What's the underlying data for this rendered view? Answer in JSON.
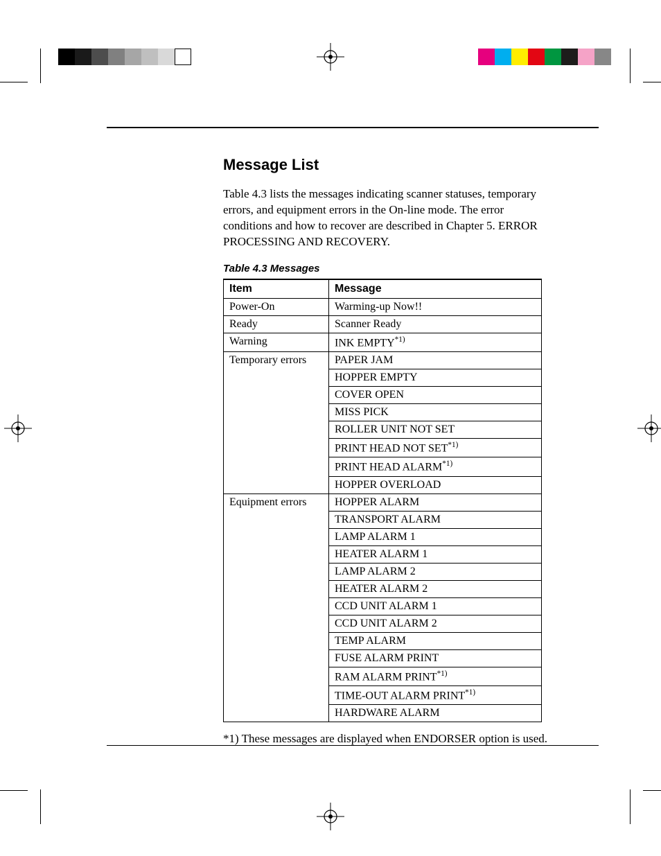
{
  "calibration": {
    "gray_shades": [
      "#000000",
      "#1a1a1a",
      "#4d4d4d",
      "#808080",
      "#a6a6a6",
      "#bfbfbf",
      "#d9d9d9",
      "#ffffff"
    ],
    "color_swatches": [
      "#e6007e",
      "#00aeef",
      "#ffed00",
      "#e30613",
      "#009640",
      "#1d1d1b",
      "#f5a3c7",
      "#878787"
    ]
  },
  "heading": "Message List",
  "intro_text": "Table 4.3 lists the messages indicating scanner statuses, temporary errors, and equipment errors in the On-line mode. The error conditions and how to recover are described in Chapter 5. ERROR PROCESSING AND RECOVERY.",
  "table": {
    "caption": "Table 4.3  Messages",
    "columns": [
      "Item",
      "Message"
    ],
    "groups": [
      {
        "item": "Power-On",
        "messages": [
          {
            "text": "Warming-up Now!!",
            "note": false
          }
        ]
      },
      {
        "item": "Ready",
        "messages": [
          {
            "text": "Scanner Ready",
            "note": false
          }
        ]
      },
      {
        "item": "Warning",
        "messages": [
          {
            "text": "INK EMPTY",
            "note": true
          }
        ]
      },
      {
        "item": "Temporary errors",
        "messages": [
          {
            "text": "PAPER JAM",
            "note": false
          },
          {
            "text": "HOPPER EMPTY",
            "note": false
          },
          {
            "text": "COVER OPEN",
            "note": false
          },
          {
            "text": "MISS PICK",
            "note": false
          },
          {
            "text": "ROLLER UNIT NOT SET",
            "note": false
          },
          {
            "text": "PRINT HEAD NOT SET",
            "note": true
          },
          {
            "text": "PRINT HEAD ALARM",
            "note": true
          },
          {
            "text": "HOPPER OVERLOAD",
            "note": false
          }
        ]
      },
      {
        "item": "Equipment errors",
        "messages": [
          {
            "text": "HOPPER ALARM",
            "note": false
          },
          {
            "text": "TRANSPORT ALARM",
            "note": false
          },
          {
            "text": "LAMP ALARM 1",
            "note": false
          },
          {
            "text": "HEATER ALARM 1",
            "note": false
          },
          {
            "text": "LAMP ALARM 2",
            "note": false
          },
          {
            "text": "HEATER ALARM 2",
            "note": false
          },
          {
            "text": "CCD UNIT ALARM 1",
            "note": false
          },
          {
            "text": "CCD UNIT ALARM 2",
            "note": false
          },
          {
            "text": "TEMP ALARM",
            "note": false
          },
          {
            "text": "FUSE ALARM PRINT",
            "note": false
          },
          {
            "text": "RAM ALARM PRINT",
            "note": true
          },
          {
            "text": "TIME-OUT ALARM PRINT",
            "note": true
          },
          {
            "text": "HARDWARE ALARM",
            "note": false
          }
        ]
      }
    ]
  },
  "footnote_marker": "*1)",
  "footnote": "*1)  These messages are displayed when ENDORSER option is used."
}
